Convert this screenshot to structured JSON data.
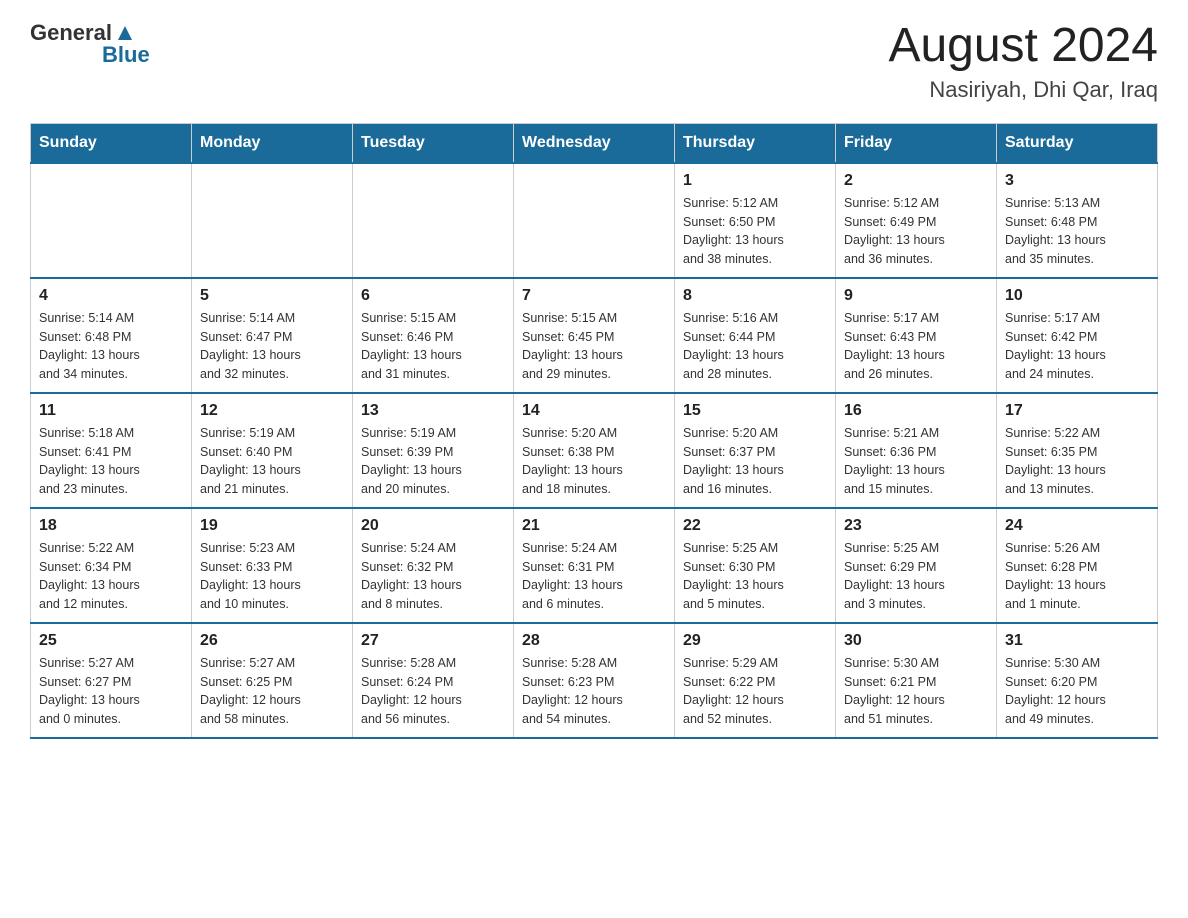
{
  "header": {
    "logo_general": "General",
    "logo_blue": "Blue",
    "title": "August 2024",
    "subtitle": "Nasiriyah, Dhi Qar, Iraq"
  },
  "days_of_week": [
    "Sunday",
    "Monday",
    "Tuesday",
    "Wednesday",
    "Thursday",
    "Friday",
    "Saturday"
  ],
  "weeks": [
    [
      {
        "day": "",
        "info": ""
      },
      {
        "day": "",
        "info": ""
      },
      {
        "day": "",
        "info": ""
      },
      {
        "day": "",
        "info": ""
      },
      {
        "day": "1",
        "info": "Sunrise: 5:12 AM\nSunset: 6:50 PM\nDaylight: 13 hours\nand 38 minutes."
      },
      {
        "day": "2",
        "info": "Sunrise: 5:12 AM\nSunset: 6:49 PM\nDaylight: 13 hours\nand 36 minutes."
      },
      {
        "day": "3",
        "info": "Sunrise: 5:13 AM\nSunset: 6:48 PM\nDaylight: 13 hours\nand 35 minutes."
      }
    ],
    [
      {
        "day": "4",
        "info": "Sunrise: 5:14 AM\nSunset: 6:48 PM\nDaylight: 13 hours\nand 34 minutes."
      },
      {
        "day": "5",
        "info": "Sunrise: 5:14 AM\nSunset: 6:47 PM\nDaylight: 13 hours\nand 32 minutes."
      },
      {
        "day": "6",
        "info": "Sunrise: 5:15 AM\nSunset: 6:46 PM\nDaylight: 13 hours\nand 31 minutes."
      },
      {
        "day": "7",
        "info": "Sunrise: 5:15 AM\nSunset: 6:45 PM\nDaylight: 13 hours\nand 29 minutes."
      },
      {
        "day": "8",
        "info": "Sunrise: 5:16 AM\nSunset: 6:44 PM\nDaylight: 13 hours\nand 28 minutes."
      },
      {
        "day": "9",
        "info": "Sunrise: 5:17 AM\nSunset: 6:43 PM\nDaylight: 13 hours\nand 26 minutes."
      },
      {
        "day": "10",
        "info": "Sunrise: 5:17 AM\nSunset: 6:42 PM\nDaylight: 13 hours\nand 24 minutes."
      }
    ],
    [
      {
        "day": "11",
        "info": "Sunrise: 5:18 AM\nSunset: 6:41 PM\nDaylight: 13 hours\nand 23 minutes."
      },
      {
        "day": "12",
        "info": "Sunrise: 5:19 AM\nSunset: 6:40 PM\nDaylight: 13 hours\nand 21 minutes."
      },
      {
        "day": "13",
        "info": "Sunrise: 5:19 AM\nSunset: 6:39 PM\nDaylight: 13 hours\nand 20 minutes."
      },
      {
        "day": "14",
        "info": "Sunrise: 5:20 AM\nSunset: 6:38 PM\nDaylight: 13 hours\nand 18 minutes."
      },
      {
        "day": "15",
        "info": "Sunrise: 5:20 AM\nSunset: 6:37 PM\nDaylight: 13 hours\nand 16 minutes."
      },
      {
        "day": "16",
        "info": "Sunrise: 5:21 AM\nSunset: 6:36 PM\nDaylight: 13 hours\nand 15 minutes."
      },
      {
        "day": "17",
        "info": "Sunrise: 5:22 AM\nSunset: 6:35 PM\nDaylight: 13 hours\nand 13 minutes."
      }
    ],
    [
      {
        "day": "18",
        "info": "Sunrise: 5:22 AM\nSunset: 6:34 PM\nDaylight: 13 hours\nand 12 minutes."
      },
      {
        "day": "19",
        "info": "Sunrise: 5:23 AM\nSunset: 6:33 PM\nDaylight: 13 hours\nand 10 minutes."
      },
      {
        "day": "20",
        "info": "Sunrise: 5:24 AM\nSunset: 6:32 PM\nDaylight: 13 hours\nand 8 minutes."
      },
      {
        "day": "21",
        "info": "Sunrise: 5:24 AM\nSunset: 6:31 PM\nDaylight: 13 hours\nand 6 minutes."
      },
      {
        "day": "22",
        "info": "Sunrise: 5:25 AM\nSunset: 6:30 PM\nDaylight: 13 hours\nand 5 minutes."
      },
      {
        "day": "23",
        "info": "Sunrise: 5:25 AM\nSunset: 6:29 PM\nDaylight: 13 hours\nand 3 minutes."
      },
      {
        "day": "24",
        "info": "Sunrise: 5:26 AM\nSunset: 6:28 PM\nDaylight: 13 hours\nand 1 minute."
      }
    ],
    [
      {
        "day": "25",
        "info": "Sunrise: 5:27 AM\nSunset: 6:27 PM\nDaylight: 13 hours\nand 0 minutes."
      },
      {
        "day": "26",
        "info": "Sunrise: 5:27 AM\nSunset: 6:25 PM\nDaylight: 12 hours\nand 58 minutes."
      },
      {
        "day": "27",
        "info": "Sunrise: 5:28 AM\nSunset: 6:24 PM\nDaylight: 12 hours\nand 56 minutes."
      },
      {
        "day": "28",
        "info": "Sunrise: 5:28 AM\nSunset: 6:23 PM\nDaylight: 12 hours\nand 54 minutes."
      },
      {
        "day": "29",
        "info": "Sunrise: 5:29 AM\nSunset: 6:22 PM\nDaylight: 12 hours\nand 52 minutes."
      },
      {
        "day": "30",
        "info": "Sunrise: 5:30 AM\nSunset: 6:21 PM\nDaylight: 12 hours\nand 51 minutes."
      },
      {
        "day": "31",
        "info": "Sunrise: 5:30 AM\nSunset: 6:20 PM\nDaylight: 12 hours\nand 49 minutes."
      }
    ]
  ]
}
